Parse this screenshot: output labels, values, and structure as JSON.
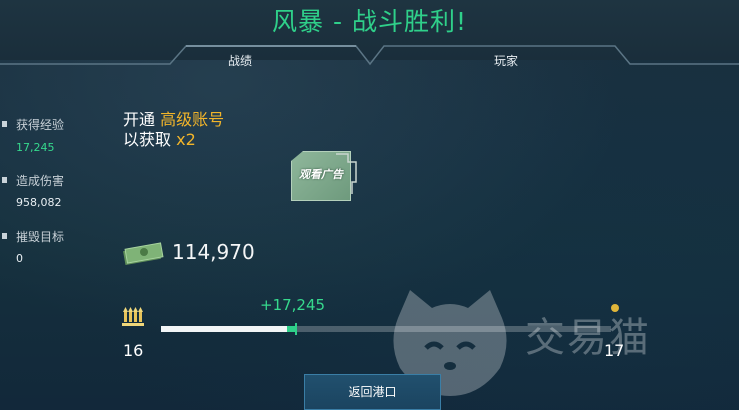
{
  "header": {
    "title": "风暴 - 战斗胜利!",
    "tabs": [
      {
        "label": "战绩",
        "active": true
      },
      {
        "label": "玩家",
        "active": false
      }
    ]
  },
  "stats": [
    {
      "icon": "experience-icon",
      "label": "获得经验",
      "value": "17,245",
      "color": "#36d98d"
    },
    {
      "icon": "damage-icon",
      "label": "造成伤害",
      "value": "958,082",
      "color": "#e8eef2"
    },
    {
      "icon": "destroyed-icon",
      "label": "摧毁目标",
      "value": "0",
      "color": "#e8eef2"
    }
  ],
  "promo": {
    "line1_prefix": "开通 ",
    "line1_highlight": "高级账号",
    "line2_prefix": "以获取 ",
    "line2_highlight": "x2"
  },
  "ad_button": {
    "label": "观看广告"
  },
  "credits": {
    "value": "114,970"
  },
  "progress": {
    "gain_text": "+17,245",
    "current_rank": "16",
    "next_rank": "17",
    "base_fraction": 0.28,
    "gain_fraction": 0.02
  },
  "footer": {
    "return_label": "返回港口"
  },
  "watermark": {
    "text": "交易猫"
  },
  "colors": {
    "accent_green": "#2fd08a",
    "gold": "#f2b52a",
    "button": "#21506e"
  }
}
